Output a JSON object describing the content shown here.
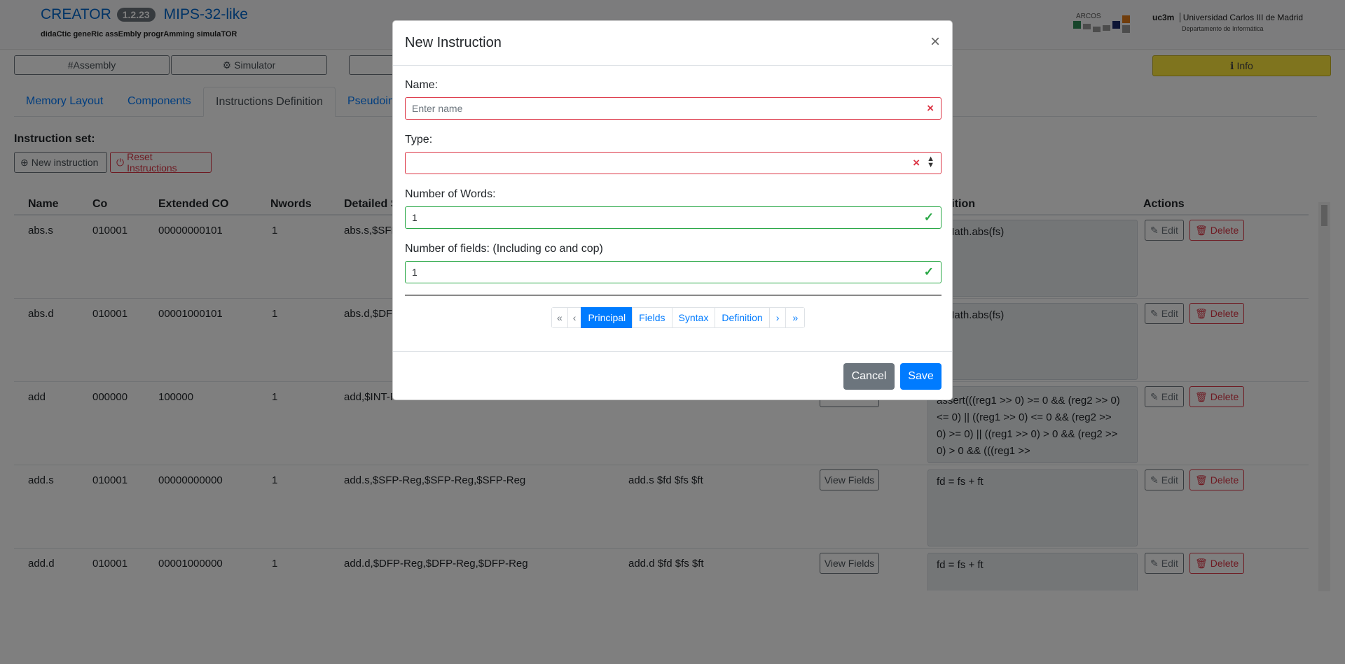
{
  "app": {
    "name": "CREATOR",
    "version": "1.2.23",
    "architecture": "MIPS-32-like",
    "subtitle": "didaCtic geneRic assEmbly progrAmming simulaTOR",
    "arcos_logo_text": "ARCOS",
    "uc3m_logo_text": "uc3m",
    "university": "Universidad Carlos III de Madrid",
    "department": "Departamento de Informática"
  },
  "nav": {
    "assembly": "#Assembly",
    "simulator": "Simulator",
    "info": "Info"
  },
  "tabs": [
    "Memory Layout",
    "Components",
    "Instructions Definition",
    "Pseudoin"
  ],
  "instruction_set": {
    "label": "Instruction set:",
    "new_instruction": "New instruction",
    "reset_instructions": "Reset Instructions"
  },
  "table": {
    "headers": [
      "Name",
      "Co",
      "Extended CO",
      "Nwords",
      "Detailed S",
      "inition",
      "Actions"
    ],
    "view_fields_label": "View Fields",
    "edit_label": "Edit",
    "delete_label": "Delete",
    "rows": [
      {
        "name": "abs.s",
        "co": "010001",
        "ext": "00000000101",
        "nwords": "1",
        "detailed": "abs.s,$SFP-",
        "signature": "",
        "definition": "= Math.abs(fs)"
      },
      {
        "name": "abs.d",
        "co": "010001",
        "ext": "00001000101",
        "nwords": "1",
        "detailed": "abs.d,$DFP",
        "signature": "",
        "definition": "= Math.abs(fs)"
      },
      {
        "name": "add",
        "co": "000000",
        "ext": "100000",
        "nwords": "1",
        "detailed": "add,$INT-R",
        "signature": "",
        "definition": "assert(((reg1 >> 0) >= 0 && (reg2 >> 0) <= 0) || ((reg1 >> 0) <= 0 && (reg2 >> 0) >= 0) || ((reg1 >> 0) > 0 && (reg2 >> 0) > 0 && (((reg1 >>"
      },
      {
        "name": "add.s",
        "co": "010001",
        "ext": "00000000000",
        "nwords": "1",
        "detailed": "add.s,$SFP-Reg,$SFP-Reg,$SFP-Reg",
        "signature": "add.s $fd $fs $ft",
        "definition": "fd = fs + ft"
      },
      {
        "name": "add.d",
        "co": "010001",
        "ext": "00001000000",
        "nwords": "1",
        "detailed": "add.d,$DFP-Reg,$DFP-Reg,$DFP-Reg",
        "signature": "add.d $fd $fs $ft",
        "definition": "fd = fs + ft"
      }
    ]
  },
  "modal": {
    "title": "New Instruction",
    "close": "×",
    "name_label": "Name:",
    "name_placeholder": "Enter name",
    "type_label": "Type:",
    "nwords_label": "Number of Words:",
    "nwords_value": "1",
    "nfields_label": "Number of fields: (Including co and cop)",
    "nfields_value": "1",
    "pager": {
      "first": "«",
      "prev": "‹",
      "pages": [
        "Principal",
        "Fields",
        "Syntax",
        "Definition"
      ],
      "active": "Principal",
      "next": "›",
      "last": "»"
    },
    "cancel": "Cancel",
    "save": "Save"
  },
  "icons": {
    "invalid": "×",
    "valid": "✓",
    "select": "▲▼",
    "colors": {
      "invalid": "#dc3545",
      "valid": "#28a745",
      "primary": "#007bff",
      "info": "#ffe83d"
    }
  }
}
